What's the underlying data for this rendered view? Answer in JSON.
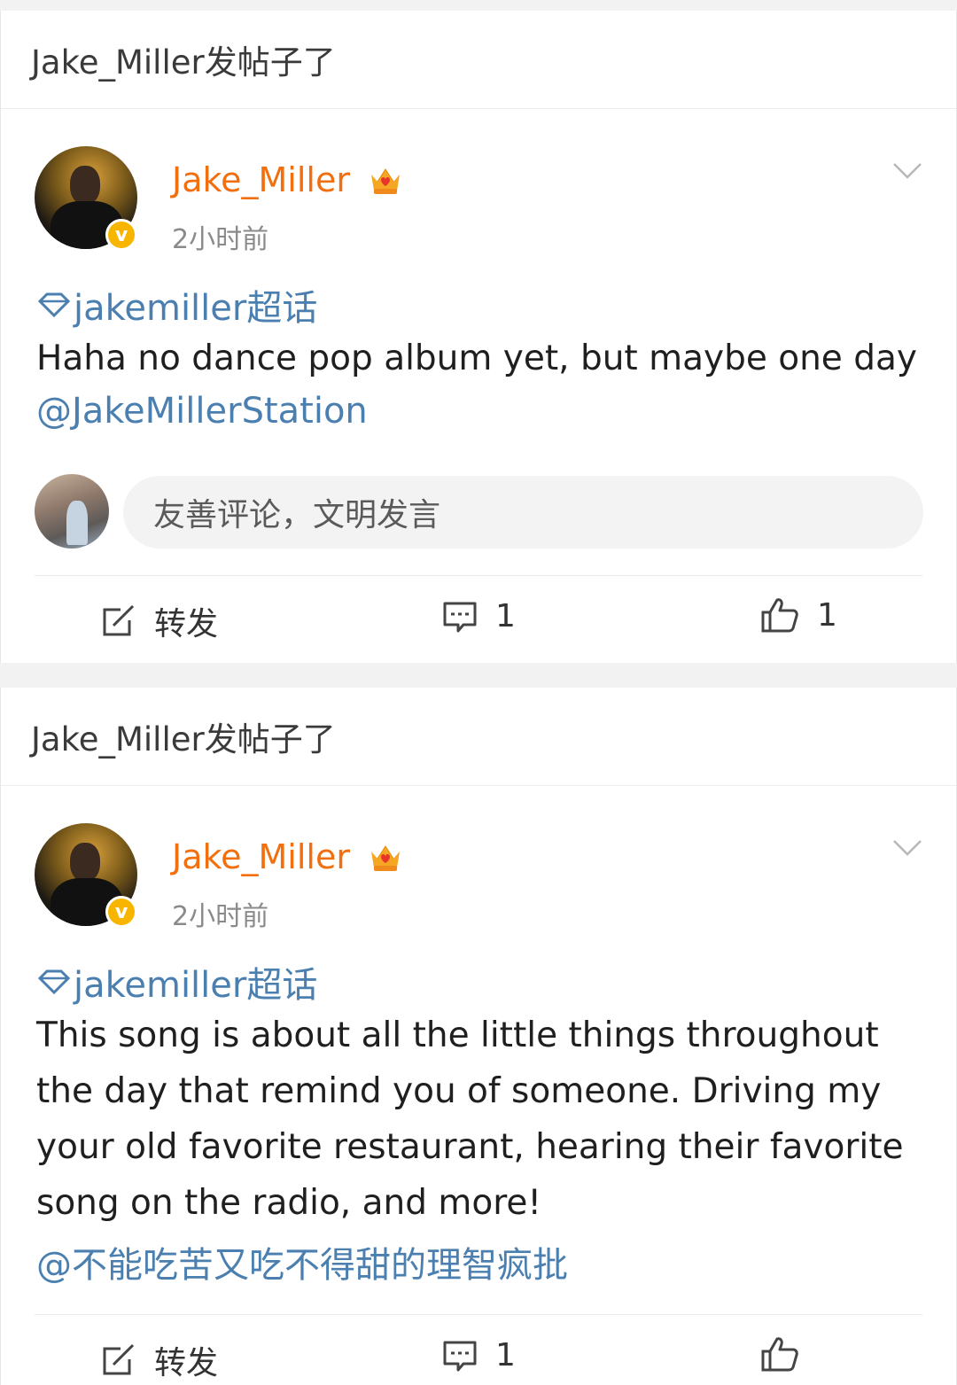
{
  "posts": [
    {
      "header": "Jake_Miller发帖子了",
      "username": "Jake_Miller",
      "time": "2小时前",
      "verified": "v",
      "topic": "jakemiller超话",
      "body": "Haha no dance pop album yet, but maybe one day",
      "mention": "@JakeMillerStation",
      "comment_placeholder": "友善评论，文明发言",
      "actions": {
        "repost": "转发",
        "comments": "1",
        "likes": "1"
      }
    },
    {
      "header": "Jake_Miller发帖子了",
      "username": "Jake_Miller",
      "time": "2小时前",
      "verified": "v",
      "topic": "jakemiller超话",
      "body_lines": [
        "This song is about all the little things throughout",
        "the day that remind you of someone. Driving my",
        "your old favorite restaurant, hearing their favorite",
        "song on the radio, and more!"
      ],
      "mention": "@不能吃苦又吃不得甜的理智疯批",
      "actions": {
        "repost": "转发",
        "comments": "1"
      }
    }
  ],
  "colors": {
    "username": "#f26f0f",
    "link": "#4a7fb0",
    "badge": "#f8b500",
    "text": "#1f1f1f",
    "muted": "#8a8a8a"
  },
  "icons": [
    "chevron-down-icon",
    "crown-badge-icon",
    "diamond-icon",
    "repost-icon",
    "comment-icon",
    "like-icon",
    "verified-badge-icon"
  ]
}
